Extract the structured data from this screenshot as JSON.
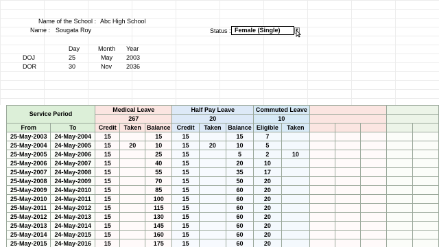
{
  "header": {
    "school_label": "Name of the School :",
    "school_value": "Abc High School",
    "name_label": "Name :",
    "name_value": "Sougata Roy",
    "status_label": "Status :",
    "status_value": "Female (Single)"
  },
  "dates": {
    "col_day": "Day",
    "col_month": "Month",
    "col_year": "Year",
    "doj_label": "DOJ",
    "doj_day": "25",
    "doj_month": "May",
    "doj_year": "2003",
    "dor_label": "DOR",
    "dor_day": "30",
    "dor_month": "Nov",
    "dor_year": "2036"
  },
  "table": {
    "service_period": "Service Period",
    "medical_leave": "Medical Leave",
    "half_pay_leave": "Half Pay Leave",
    "commuted_leave": "Commuted Leave",
    "ml_total": "267",
    "hp_total": "20",
    "cl_total": "10",
    "h_from": "From",
    "h_to": "To",
    "h_credit": "Credit",
    "h_taken": "Taken",
    "h_balance": "Balance",
    "h_eligible": "Eligible",
    "rows": [
      {
        "from": "25-May-2003",
        "to": "24-May-2004",
        "ml_credit": "15",
        "ml_taken": "",
        "ml_balance": "15",
        "hp_credit": "15",
        "hp_taken": "",
        "hp_balance": "15",
        "cl_eligible": "7",
        "cl_taken": ""
      },
      {
        "from": "25-May-2004",
        "to": "24-May-2005",
        "ml_credit": "15",
        "ml_taken": "20",
        "ml_balance": "10",
        "hp_credit": "15",
        "hp_taken": "20",
        "hp_balance": "10",
        "cl_eligible": "5",
        "cl_taken": ""
      },
      {
        "from": "25-May-2005",
        "to": "24-May-2006",
        "ml_credit": "15",
        "ml_taken": "",
        "ml_balance": "25",
        "hp_credit": "15",
        "hp_taken": "",
        "hp_balance": "5",
        "cl_eligible": "2",
        "cl_taken": "10"
      },
      {
        "from": "25-May-2006",
        "to": "24-May-2007",
        "ml_credit": "15",
        "ml_taken": "",
        "ml_balance": "40",
        "hp_credit": "15",
        "hp_taken": "",
        "hp_balance": "20",
        "cl_eligible": "10",
        "cl_taken": ""
      },
      {
        "from": "25-May-2007",
        "to": "24-May-2008",
        "ml_credit": "15",
        "ml_taken": "",
        "ml_balance": "55",
        "hp_credit": "15",
        "hp_taken": "",
        "hp_balance": "35",
        "cl_eligible": "17",
        "cl_taken": ""
      },
      {
        "from": "25-May-2008",
        "to": "24-May-2009",
        "ml_credit": "15",
        "ml_taken": "",
        "ml_balance": "70",
        "hp_credit": "15",
        "hp_taken": "",
        "hp_balance": "50",
        "cl_eligible": "20",
        "cl_taken": ""
      },
      {
        "from": "25-May-2009",
        "to": "24-May-2010",
        "ml_credit": "15",
        "ml_taken": "",
        "ml_balance": "85",
        "hp_credit": "15",
        "hp_taken": "",
        "hp_balance": "60",
        "cl_eligible": "20",
        "cl_taken": ""
      },
      {
        "from": "25-May-2010",
        "to": "24-May-2011",
        "ml_credit": "15",
        "ml_taken": "",
        "ml_balance": "100",
        "hp_credit": "15",
        "hp_taken": "",
        "hp_balance": "60",
        "cl_eligible": "20",
        "cl_taken": ""
      },
      {
        "from": "25-May-2011",
        "to": "24-May-2012",
        "ml_credit": "15",
        "ml_taken": "",
        "ml_balance": "115",
        "hp_credit": "15",
        "hp_taken": "",
        "hp_balance": "60",
        "cl_eligible": "20",
        "cl_taken": ""
      },
      {
        "from": "25-May-2012",
        "to": "24-May-2013",
        "ml_credit": "15",
        "ml_taken": "",
        "ml_balance": "130",
        "hp_credit": "15",
        "hp_taken": "",
        "hp_balance": "60",
        "cl_eligible": "20",
        "cl_taken": ""
      },
      {
        "from": "25-May-2013",
        "to": "24-May-2014",
        "ml_credit": "15",
        "ml_taken": "",
        "ml_balance": "145",
        "hp_credit": "15",
        "hp_taken": "",
        "hp_balance": "60",
        "cl_eligible": "20",
        "cl_taken": ""
      },
      {
        "from": "25-May-2014",
        "to": "24-May-2015",
        "ml_credit": "15",
        "ml_taken": "",
        "ml_balance": "160",
        "hp_credit": "15",
        "hp_taken": "",
        "hp_balance": "60",
        "cl_eligible": "20",
        "cl_taken": ""
      },
      {
        "from": "25-May-2015",
        "to": "24-May-2016",
        "ml_credit": "15",
        "ml_taken": "",
        "ml_balance": "175",
        "hp_credit": "15",
        "hp_taken": "",
        "hp_balance": "60",
        "cl_eligible": "20",
        "cl_taken": ""
      }
    ]
  },
  "colors": {
    "service_green": "#dcefd8",
    "medical_pink": "#fbe5e1",
    "halfpay_blue": "#dde9f7",
    "commuted_blue": "#d8eaf6"
  },
  "icons": {
    "dropdown": "chevron-down-icon",
    "pointer": "mouse-pointer-icon"
  }
}
